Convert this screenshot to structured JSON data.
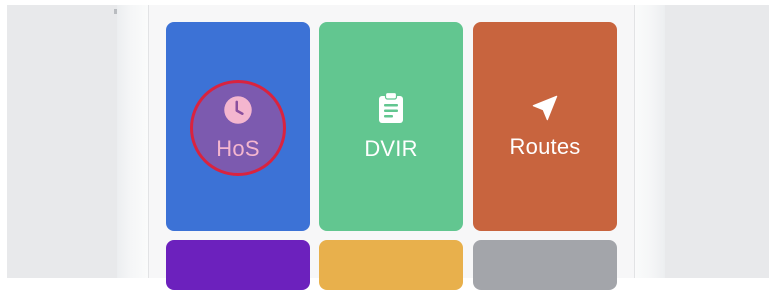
{
  "tiles": {
    "hos": {
      "label": "HoS",
      "icon": "clock-icon"
    },
    "dvir": {
      "label": "DVIR",
      "icon": "clipboard-icon"
    },
    "routes": {
      "label": "Routes",
      "icon": "navigation-arrow-icon"
    }
  },
  "colors": {
    "hos_tile": "#3c72d6",
    "dvir_tile": "#62c690",
    "routes_tile": "#c8643e",
    "purple_tile": "#6c21bd",
    "yellow_tile": "#e8b04c",
    "gray_tile": "#a3a5aa",
    "highlight_ring": "#d9233f",
    "highlight_text": "#f4b6cf"
  }
}
